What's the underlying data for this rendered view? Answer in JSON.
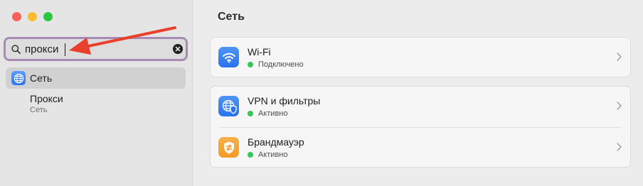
{
  "window": {
    "buttons": [
      "close",
      "minimize",
      "maximize"
    ]
  },
  "search": {
    "value": "прокси",
    "clear_icon": "clear-circle-icon",
    "icon": "magnifier-icon"
  },
  "sidebar": {
    "items": [
      {
        "label": "Сеть",
        "icon": "globe-icon"
      }
    ],
    "result": {
      "title": "Прокси",
      "subtitle": "Сеть"
    }
  },
  "main": {
    "title": "Сеть",
    "sections": [
      {
        "rows": [
          {
            "title": "Wi-Fi",
            "status": "Подключено",
            "icon": "wifi-icon"
          }
        ]
      },
      {
        "rows": [
          {
            "title": "VPN и фильтры",
            "status": "Активно",
            "icon": "vpn-globe-shield-icon"
          },
          {
            "title": "Брандмауэр",
            "status": "Активно",
            "icon": "firewall-icon"
          }
        ]
      }
    ]
  },
  "colors": {
    "accent_blue": "#2f77ef",
    "status_green": "#34c759",
    "firewall_orange": "#f39a26",
    "annotation_arrow": "#e8402b",
    "focus_ring": "#a78bb5"
  },
  "annotation": {
    "type": "arrow",
    "points_to": "search-input"
  }
}
